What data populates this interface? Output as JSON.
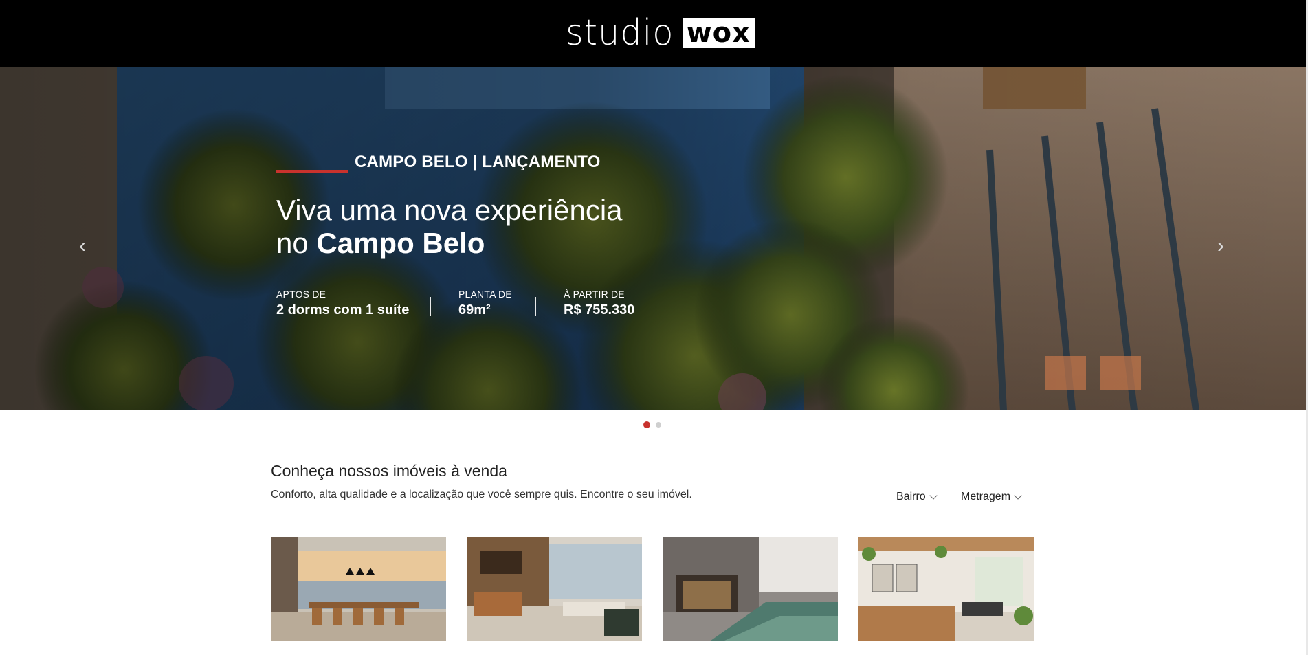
{
  "header": {
    "logo_part1": "studio",
    "logo_part2": "wox"
  },
  "hero": {
    "tag": "CAMPO BELO | LANÇAMENTO",
    "title_line1": "Viva uma nova experiência",
    "title_line2_prefix": "no",
    "title_line2_bold": "Campo Belo",
    "specs": [
      {
        "label": "APTOS DE",
        "value": "2 dorms com 1 suíte"
      },
      {
        "label": "PLANTA DE",
        "value": "69m²"
      },
      {
        "label": "À PARTIR DE",
        "value": "R$ 755.330"
      }
    ],
    "prev_icon": "chevron-left-icon",
    "next_icon": "chevron-right-icon",
    "slides_total": 2,
    "slide_active": 1
  },
  "listing": {
    "title": "Conheça nossos imóveis à venda",
    "subtitle": "Conforto, alta qualidade e a localização que você sempre quis. Encontre o seu imóvel.",
    "filters": [
      "Bairro",
      "Metragem"
    ]
  },
  "colors": {
    "accent": "#c8322d",
    "header_bg": "#000000"
  }
}
